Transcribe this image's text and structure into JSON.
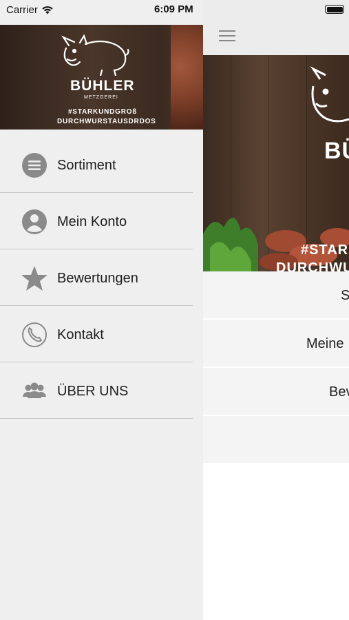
{
  "status_bar": {
    "carrier": "Carrier",
    "time": "6:09 PM"
  },
  "drawer": {
    "header": {
      "brand": "BÜHLER",
      "subtitle": "METZGEREI",
      "tagline_1": "#STARKUNDGROß",
      "tagline_2": "DURCHWURSTAUSDRDOS"
    },
    "menu": [
      {
        "label": "Sortiment",
        "icon": "list-icon"
      },
      {
        "label": "Mein Konto",
        "icon": "user-icon"
      },
      {
        "label": "Bewertungen",
        "icon": "star-icon"
      },
      {
        "label": "Kontakt",
        "icon": "phone-icon"
      },
      {
        "label": "ÜBER UNS",
        "icon": "group-icon"
      }
    ]
  },
  "main": {
    "hero": {
      "brand": "BÜH",
      "tag_1": "#STAR",
      "tag_2": "DURCHWU"
    },
    "rows": [
      {
        "label": "S"
      },
      {
        "label": "Meine"
      },
      {
        "label": "Bev"
      }
    ]
  },
  "colors": {
    "drawer_bg": "#efefef",
    "header_wood": "#3b2a20",
    "icon_gray": "#8a8a8a",
    "divider": "#c9c9c9"
  }
}
